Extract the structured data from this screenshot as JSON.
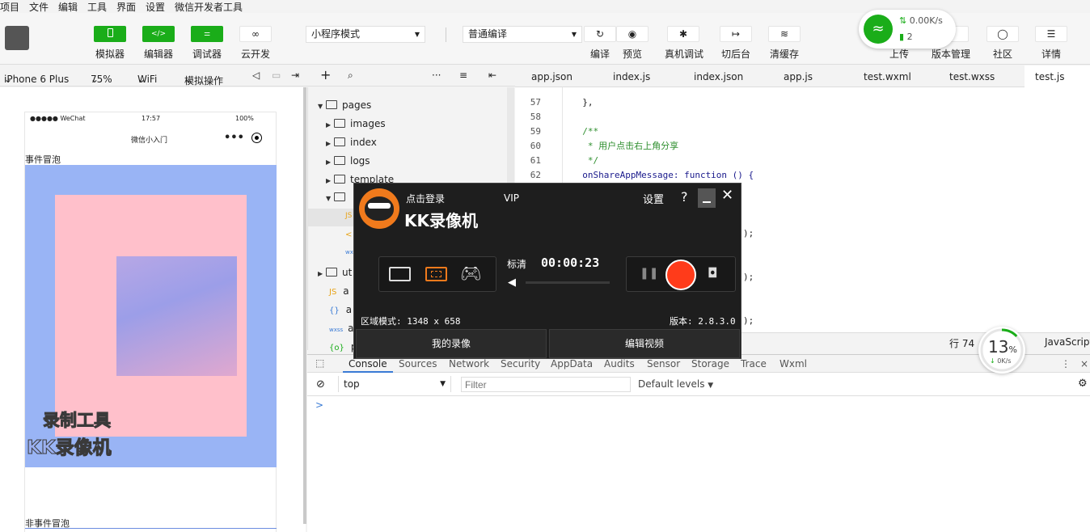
{
  "menu": [
    "项目",
    "文件",
    "编辑",
    "工具",
    "界面",
    "设置",
    "微信开发者工具"
  ],
  "toolbar": {
    "simulator": "模拟器",
    "editor": "编辑器",
    "debugger": "调试器",
    "cloud": "云开发",
    "mode": "小程序模式",
    "compile_mode": "普通编译",
    "compile": "编译",
    "preview": "预览",
    "real_debug": "真机调试",
    "background": "切后台",
    "clear_cache": "清缓存",
    "upload": "上传",
    "version": "版本管理",
    "community": "社区",
    "details": "详情",
    "editor_icon": "</>"
  },
  "wifi": {
    "speed": "0.00K/s",
    "count": "2"
  },
  "subbar": {
    "device": "iPhone 6 Plus",
    "zoom": "75%",
    "network": "WiFi",
    "simulate": "模拟操作"
  },
  "phone": {
    "carrier": "●●●●● WeChat",
    "time": "17:57",
    "battery": "100%",
    "title": "微信小入门",
    "bubble_label": "事件冒泡",
    "non_bubble_label": "非事件冒泡",
    "watermark1": "录制工具",
    "watermark2": "KK录像机"
  },
  "tree": {
    "pages": "pages",
    "images": "images",
    "index": "index",
    "logs": "logs",
    "template": "template",
    "ut": "ut",
    "a1": "a",
    "a2": "a",
    "a3": "a",
    "p": "p"
  },
  "tabs": [
    "app.json",
    "index.js",
    "index.json",
    "app.js",
    "test.wxml",
    "test.wxss",
    "test.js"
  ],
  "code": [
    {
      "n": "57",
      "t": "  },"
    },
    {
      "n": "58",
      "t": ""
    },
    {
      "n": "59",
      "t": "  /**"
    },
    {
      "n": "60",
      "t": "   * 用户点击右上角分享"
    },
    {
      "n": "61",
      "t": "   */"
    },
    {
      "n": "62",
      "t": "  onShareAppMessage: function () {"
    }
  ],
  "code_frag": {
    "a": ");",
    "b": ");",
    "c": ");"
  },
  "status": {
    "line": "行 74",
    "lang": "JavaScript"
  },
  "cpu": {
    "percent": "13",
    "unit": "%",
    "rate": "0K/s"
  },
  "devtools": {
    "tabs": [
      "Console",
      "Sources",
      "Network",
      "Security",
      "AppData",
      "Audits",
      "Sensor",
      "Storage",
      "Trace",
      "Wxml"
    ],
    "context": "top",
    "filter_placeholder": "Filter",
    "levels": "Default levels",
    "prompt": ">"
  },
  "kk": {
    "login": "点击登录",
    "vip": "VIP",
    "settings": "设置",
    "help": "?",
    "brand": "KK录像机",
    "quality": "标清",
    "timer": "00:00:23",
    "mode": "区域模式: 1348 x 658",
    "version": "版本: 2.8.3.0",
    "my_videos": "我的录像",
    "edit_video": "编辑视频"
  },
  "colors": {
    "green": "#1aad19",
    "pink": "#ffc0cb",
    "blue": "#99b4f5",
    "record": "#ff3b1a",
    "orange": "#f07a1c"
  }
}
